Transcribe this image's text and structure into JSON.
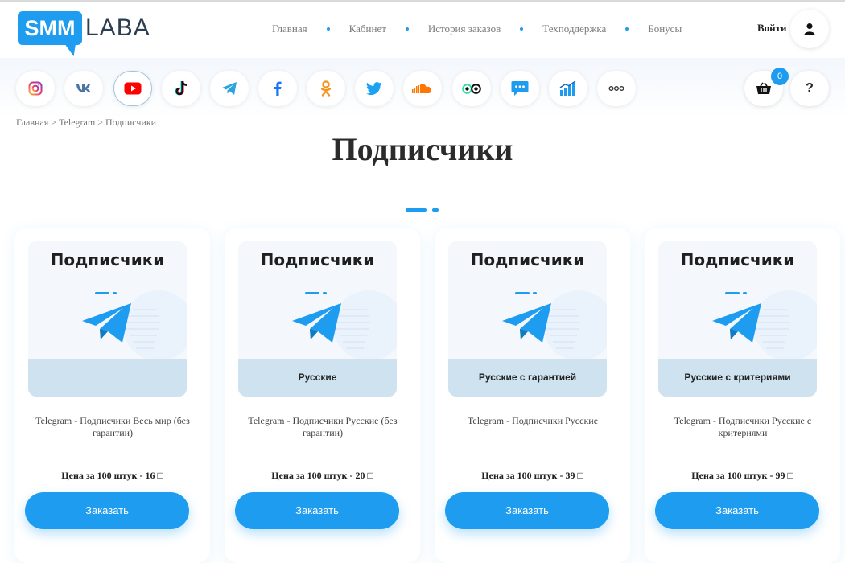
{
  "header": {
    "logo_mark": "SMM",
    "logo_text": "LABA",
    "nav": [
      "Главная",
      "Кабинет",
      "История заказов",
      "Техподдержка",
      "Бонусы"
    ],
    "login_label": "Войти",
    "user_icon": "user-icon"
  },
  "social_bar": {
    "networks": [
      "instagram",
      "vk",
      "youtube",
      "tiktok",
      "telegram",
      "facebook",
      "odnoklassniki",
      "twitter",
      "soundcloud",
      "tripadvisor",
      "chat",
      "stats",
      "more"
    ],
    "active_network": "telegram",
    "cart_count": "0",
    "help_label": "?"
  },
  "breadcrumb": [
    "Главная",
    "Telegram",
    "Подписчики"
  ],
  "breadcrumb_separator": ">",
  "page_title": "Подписчики",
  "colors": {
    "accent": "#1e9cf0",
    "band": "#cfe2f0",
    "card_image_bg": "#f4f8fd"
  },
  "cards": [
    {
      "image_title": "Подписчики",
      "image_subtitle": "",
      "description": "Telegram - Подписчики Весь мир (без гарантии)",
      "price": "Цена за 100 штук - 16 ",
      "currency_glyph": "□",
      "button_label": "Заказать"
    },
    {
      "image_title": "Подписчики",
      "image_subtitle": "Русские",
      "description": "Telegram - Подписчики Русские (без гарантии)",
      "price": "Цена за 100 штук - 20 ",
      "currency_glyph": "□",
      "button_label": "Заказать"
    },
    {
      "image_title": "Подписчики",
      "image_subtitle": "Русские с гарантией",
      "description": "Telegram - Подписчики Русские",
      "price": "Цена за 100 штук - 39 ",
      "currency_glyph": "□",
      "button_label": "Заказать"
    },
    {
      "image_title": "Подписчики",
      "image_subtitle": "Русские с критериями",
      "description": "Telegram - Подписчики Русские с критериями",
      "price": "Цена за 100 штук - 99 ",
      "currency_glyph": "□",
      "button_label": "Заказать"
    }
  ]
}
